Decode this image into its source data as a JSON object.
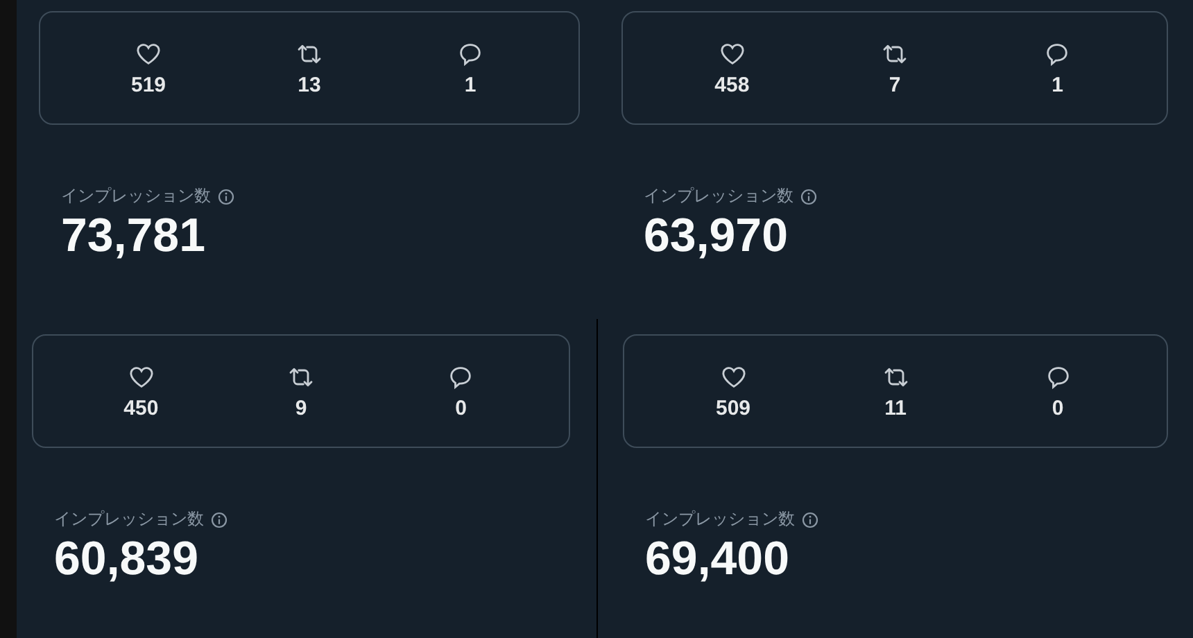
{
  "posts": [
    {
      "stats": [
        {
          "kind": "like",
          "value": "519"
        },
        {
          "kind": "repost",
          "value": "13"
        },
        {
          "kind": "reply",
          "value": "1"
        }
      ],
      "impressions_label": "インプレッション数",
      "impressions": "73,781"
    },
    {
      "stats": [
        {
          "kind": "like",
          "value": "458"
        },
        {
          "kind": "repost",
          "value": "7"
        },
        {
          "kind": "reply",
          "value": "1"
        }
      ],
      "impressions_label": "インプレッション数",
      "impressions": "63,970"
    },
    {
      "stats": [
        {
          "kind": "like",
          "value": "450"
        },
        {
          "kind": "repost",
          "value": "9"
        },
        {
          "kind": "reply",
          "value": "0"
        }
      ],
      "impressions_label": "インプレッション数",
      "impressions": "60,839"
    },
    {
      "stats": [
        {
          "kind": "like",
          "value": "509"
        },
        {
          "kind": "repost",
          "value": "11"
        },
        {
          "kind": "reply",
          "value": "0"
        }
      ],
      "impressions_label": "インプレッション数",
      "impressions": "69,400"
    }
  ]
}
